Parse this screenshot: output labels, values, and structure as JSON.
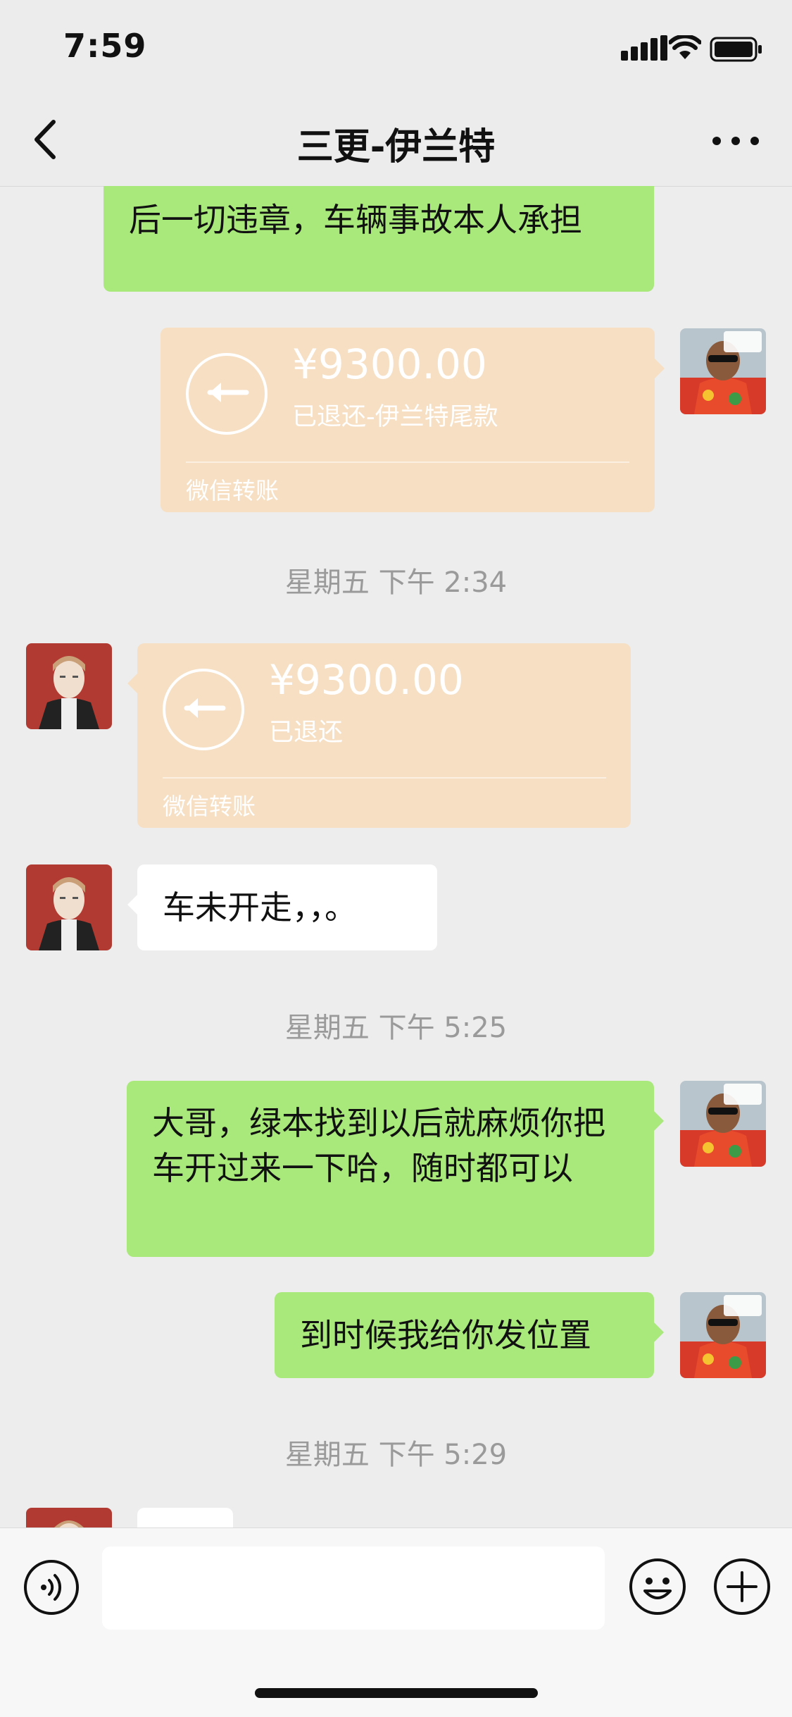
{
  "status_bar": {
    "time": "7:59"
  },
  "nav": {
    "title": "三更-伊兰特"
  },
  "messages": {
    "m1": "后一切违章，车辆事故本人承担",
    "transfer1": {
      "amount": "¥9300.00",
      "note": "已退还-伊兰特尾款",
      "label": "微信转账"
    },
    "ts1": "星期五 下午 2:34",
    "transfer2": {
      "amount": "¥9300.00",
      "note": "已退还",
      "label": "微信转账"
    },
    "m2": "车未开走，，。",
    "ts2": "星期五 下午 5:25",
    "m3": "大哥，绿本找到以后就麻烦你把车开过来一下哈，随时都可以",
    "m4": "到时候我给你发位置",
    "ts3": "星期五 下午 5:29"
  },
  "input": {
    "placeholder": ""
  }
}
